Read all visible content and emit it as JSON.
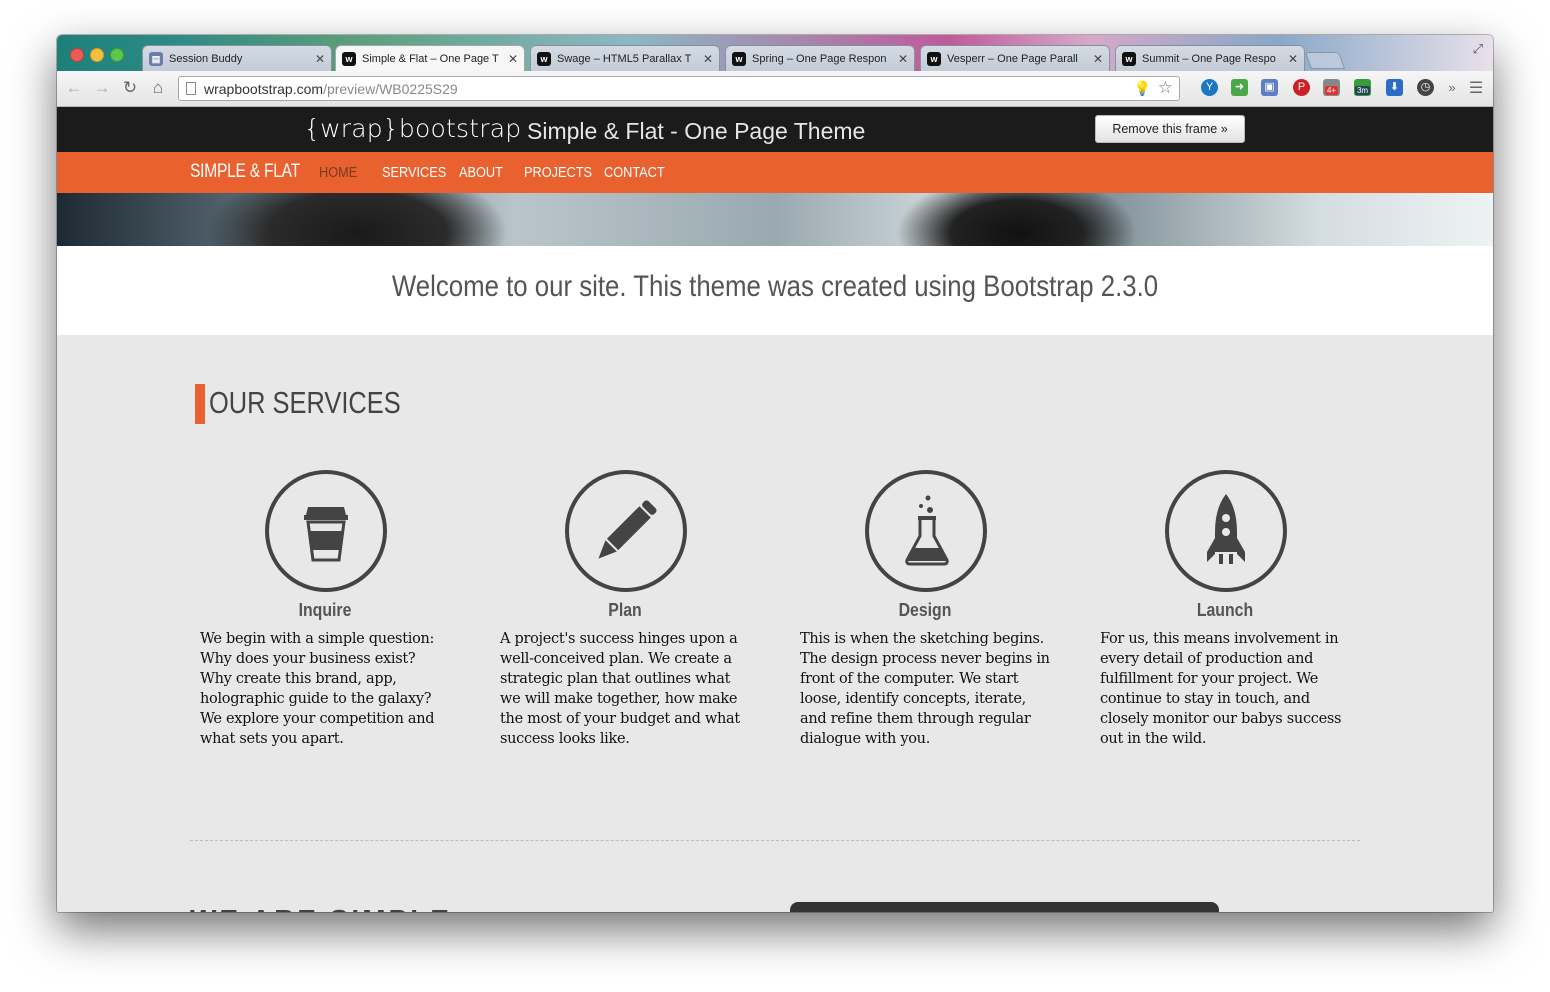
{
  "browser": {
    "tabs": [
      {
        "label": "Session Buddy",
        "favicon": "session-buddy",
        "active": false
      },
      {
        "label": "Simple & Flat – One Page T",
        "favicon": "wrapbootstrap",
        "active": true
      },
      {
        "label": "Swage – HTML5 Parallax T",
        "favicon": "wrapbootstrap",
        "active": false
      },
      {
        "label": "Spring – One Page Respon",
        "favicon": "wrapbootstrap",
        "active": false
      },
      {
        "label": "Vesperr – One Page Parall",
        "favicon": "wrapbootstrap",
        "active": false
      },
      {
        "label": "Summit – One Page Respo",
        "favicon": "wrapbootstrap",
        "active": false
      }
    ],
    "url_domain": "wrapbootstrap.com",
    "url_path": "/preview/WB0225S29",
    "extension_badges": {
      "gmail": "4+",
      "timer": "3m"
    }
  },
  "frame": {
    "logo": "{wrap}bootstrap",
    "theme_title": "Simple & Flat - One Page Theme",
    "remove_button": "Remove this frame »"
  },
  "site": {
    "brand": "SIMPLE & FLAT",
    "nav": [
      "HOME",
      "SERVICES",
      "ABOUT",
      "PROJECTS",
      "CONTACT"
    ],
    "active_nav": "HOME",
    "accent_color": "#e9612f",
    "welcome": "Welcome to our site. This theme was created using Bootstrap 2.3.0",
    "services_heading": "OUR SERVICES",
    "services": [
      {
        "icon": "coffee-cup-icon",
        "title": "Inquire",
        "desc": "We begin with a simple question: Why does your business exist? Why create this brand, app, holographic guide to the galaxy? We explore your competition and what sets you apart."
      },
      {
        "icon": "pencil-icon",
        "title": "Plan",
        "desc": "A project's success hinges upon a well-conceived plan. We create a strategic plan that outlines what we will make together, how make the most of your budget and what success looks like."
      },
      {
        "icon": "flask-icon",
        "title": "Design",
        "desc": "This is when the sketching begins. The design process never begins in front of the computer. We start loose, identify concepts, iterate, and refine them through regular dialogue with you."
      },
      {
        "icon": "rocket-icon",
        "title": "Launch",
        "desc": "For us, this means involvement in every detail of production and fulfillment for your project. We continue to stay in touch, and closely monitor our babys success out in the wild."
      }
    ],
    "next_heading_partial": "WE ARE SIMPLE"
  }
}
